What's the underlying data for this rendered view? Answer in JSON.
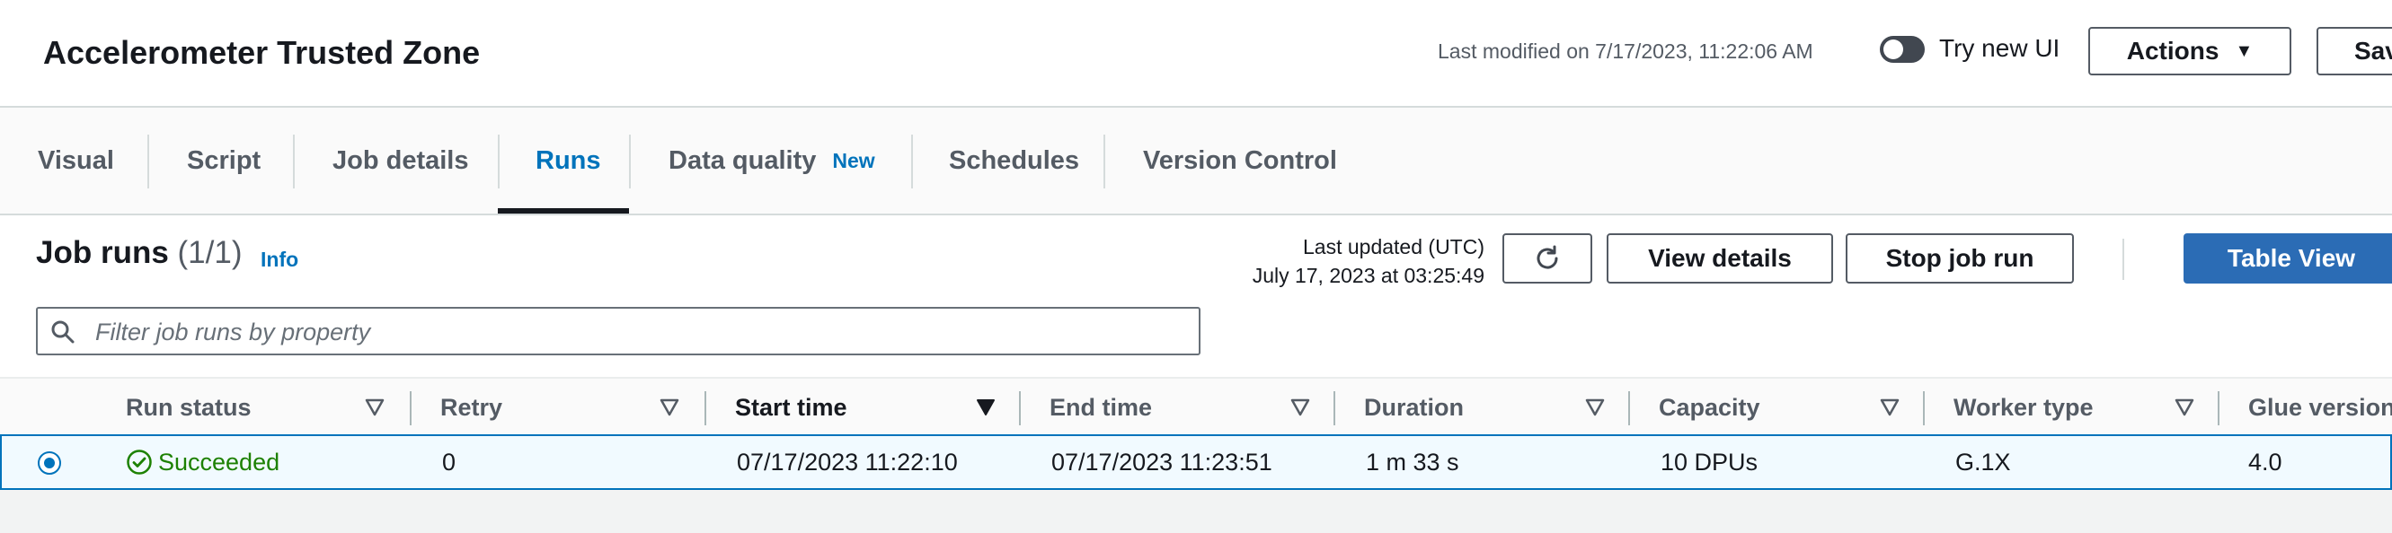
{
  "header": {
    "job_title": "Accelerometer Trusted Zone",
    "last_modified": "Last modified on 7/17/2023, 11:22:06 AM",
    "try_new_ui_label": "Try new UI",
    "actions_label": "Actions",
    "save_label": "Sav"
  },
  "tabs": [
    {
      "label": "Visual"
    },
    {
      "label": "Script"
    },
    {
      "label": "Job details"
    },
    {
      "label": "Runs"
    },
    {
      "label": "Data quality",
      "badge": "New"
    },
    {
      "label": "Schedules"
    },
    {
      "label": "Version Control"
    }
  ],
  "active_tab": "Runs",
  "job_runs": {
    "title": "Job runs",
    "count": "(1/1)",
    "info_label": "Info",
    "last_updated_label": "Last updated (UTC)",
    "last_updated_value": "July 17, 2023 at 03:25:49",
    "view_details_label": "View details",
    "stop_job_run_label": "Stop job run",
    "table_view_label": "Table View",
    "filter_placeholder": "Filter job runs by property"
  },
  "table": {
    "columns": [
      "Run status",
      "Retry",
      "Start time",
      "End time",
      "Duration",
      "Capacity",
      "Worker type",
      "Glue version"
    ],
    "sorted_column": "Start time",
    "rows": [
      {
        "run_status": "Succeeded",
        "retry": "0",
        "start_time": "07/17/2023 11:22:10",
        "end_time": "07/17/2023 11:23:51",
        "duration": "1 m 33 s",
        "capacity": "10 DPUs",
        "worker_type": "G.1X",
        "glue_version": "4.0",
        "selected": true
      }
    ]
  },
  "colors": {
    "link_blue": "#0073bb",
    "primary_button": "#2b6cb5",
    "success_green": "#1d8102",
    "text_dark": "#16191f",
    "text_muted": "#545b64"
  }
}
